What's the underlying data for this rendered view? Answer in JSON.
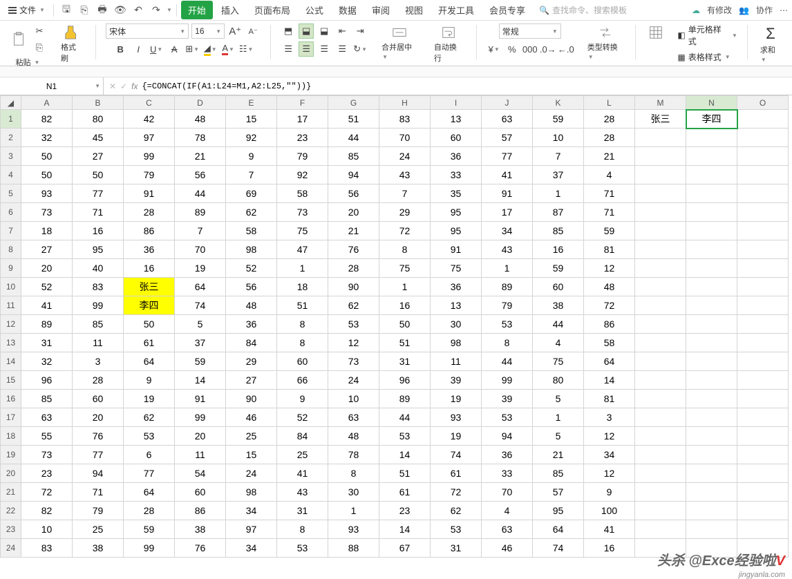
{
  "topbar": {
    "file_label": "文件",
    "tabs": [
      "开始",
      "插入",
      "页面布局",
      "公式",
      "数据",
      "审阅",
      "视图",
      "开发工具",
      "会员专享"
    ],
    "active_tab": 0,
    "search_placeholder": "查找命令、搜索模板",
    "status_modified": "有修改",
    "status_coop": "协作"
  },
  "ribbon": {
    "paste": "粘贴",
    "format_painter": "格式刷",
    "font_name": "宋体",
    "font_size": "16",
    "merge_center": "合并居中",
    "auto_wrap": "自动换行",
    "format_general": "常规",
    "type_convert": "类型转换",
    "cell_format": "单元格样式",
    "table_style": "表格样式",
    "sum": "求和"
  },
  "formula": {
    "cell_ref": "N1",
    "fx_label": "fx",
    "formula_text": "{=CONCAT(IF(A1:L24=M1,A2:L25,\"\"))}"
  },
  "columns": [
    "A",
    "B",
    "C",
    "D",
    "E",
    "F",
    "G",
    "H",
    "I",
    "J",
    "K",
    "L",
    "M",
    "N",
    "O"
  ],
  "selected_col": "N",
  "selected_row": 1,
  "highlight_cells": [
    "C10",
    "C11"
  ],
  "rows": [
    [
      "82",
      "80",
      "42",
      "48",
      "15",
      "17",
      "51",
      "83",
      "13",
      "63",
      "59",
      "28",
      "张三",
      "李四",
      ""
    ],
    [
      "32",
      "45",
      "97",
      "78",
      "92",
      "23",
      "44",
      "70",
      "60",
      "57",
      "10",
      "28",
      "",
      "",
      ""
    ],
    [
      "50",
      "27",
      "99",
      "21",
      "9",
      "79",
      "85",
      "24",
      "36",
      "77",
      "7",
      "21",
      "",
      "",
      ""
    ],
    [
      "50",
      "50",
      "79",
      "56",
      "7",
      "92",
      "94",
      "43",
      "33",
      "41",
      "37",
      "4",
      "",
      "",
      ""
    ],
    [
      "93",
      "77",
      "91",
      "44",
      "69",
      "58",
      "56",
      "7",
      "35",
      "91",
      "1",
      "71",
      "",
      "",
      ""
    ],
    [
      "73",
      "71",
      "28",
      "89",
      "62",
      "73",
      "20",
      "29",
      "95",
      "17",
      "87",
      "71",
      "",
      "",
      ""
    ],
    [
      "18",
      "16",
      "86",
      "7",
      "58",
      "75",
      "21",
      "72",
      "95",
      "34",
      "85",
      "59",
      "",
      "",
      ""
    ],
    [
      "27",
      "95",
      "36",
      "70",
      "98",
      "47",
      "76",
      "8",
      "91",
      "43",
      "16",
      "81",
      "",
      "",
      ""
    ],
    [
      "20",
      "40",
      "16",
      "19",
      "52",
      "1",
      "28",
      "75",
      "75",
      "1",
      "59",
      "12",
      "",
      "",
      ""
    ],
    [
      "52",
      "83",
      "张三",
      "64",
      "56",
      "18",
      "90",
      "1",
      "36",
      "89",
      "60",
      "48",
      "",
      "",
      ""
    ],
    [
      "41",
      "99",
      "李四",
      "74",
      "48",
      "51",
      "62",
      "16",
      "13",
      "79",
      "38",
      "72",
      "",
      "",
      ""
    ],
    [
      "89",
      "85",
      "50",
      "5",
      "36",
      "8",
      "53",
      "50",
      "30",
      "53",
      "44",
      "86",
      "",
      "",
      ""
    ],
    [
      "31",
      "11",
      "61",
      "37",
      "84",
      "8",
      "12",
      "51",
      "98",
      "8",
      "4",
      "58",
      "",
      "",
      ""
    ],
    [
      "32",
      "3",
      "64",
      "59",
      "29",
      "60",
      "73",
      "31",
      "11",
      "44",
      "75",
      "64",
      "",
      "",
      ""
    ],
    [
      "96",
      "28",
      "9",
      "14",
      "27",
      "66",
      "24",
      "96",
      "39",
      "99",
      "80",
      "14",
      "",
      "",
      ""
    ],
    [
      "85",
      "60",
      "19",
      "91",
      "90",
      "9",
      "10",
      "89",
      "19",
      "39",
      "5",
      "81",
      "",
      "",
      ""
    ],
    [
      "63",
      "20",
      "62",
      "99",
      "46",
      "52",
      "63",
      "44",
      "93",
      "53",
      "1",
      "3",
      "",
      "",
      ""
    ],
    [
      "55",
      "76",
      "53",
      "20",
      "25",
      "84",
      "48",
      "53",
      "19",
      "94",
      "5",
      "12",
      "",
      "",
      ""
    ],
    [
      "73",
      "77",
      "6",
      "11",
      "15",
      "25",
      "78",
      "14",
      "74",
      "36",
      "21",
      "34",
      "",
      "",
      ""
    ],
    [
      "23",
      "94",
      "77",
      "54",
      "24",
      "41",
      "8",
      "51",
      "61",
      "33",
      "85",
      "12",
      "",
      "",
      ""
    ],
    [
      "72",
      "71",
      "64",
      "60",
      "98",
      "43",
      "30",
      "61",
      "72",
      "70",
      "57",
      "9",
      "",
      "",
      ""
    ],
    [
      "82",
      "79",
      "28",
      "86",
      "34",
      "31",
      "1",
      "23",
      "62",
      "4",
      "95",
      "100",
      "",
      "",
      ""
    ],
    [
      "10",
      "25",
      "59",
      "38",
      "97",
      "8",
      "93",
      "14",
      "53",
      "63",
      "64",
      "41",
      "",
      "",
      ""
    ],
    [
      "83",
      "38",
      "99",
      "76",
      "34",
      "53",
      "88",
      "67",
      "31",
      "46",
      "74",
      "16",
      "",
      "",
      ""
    ]
  ],
  "watermark": {
    "text1": "头杀 @Exce",
    "text2": "经验啦",
    "red": "V",
    "sub": "jingyanla.com"
  }
}
